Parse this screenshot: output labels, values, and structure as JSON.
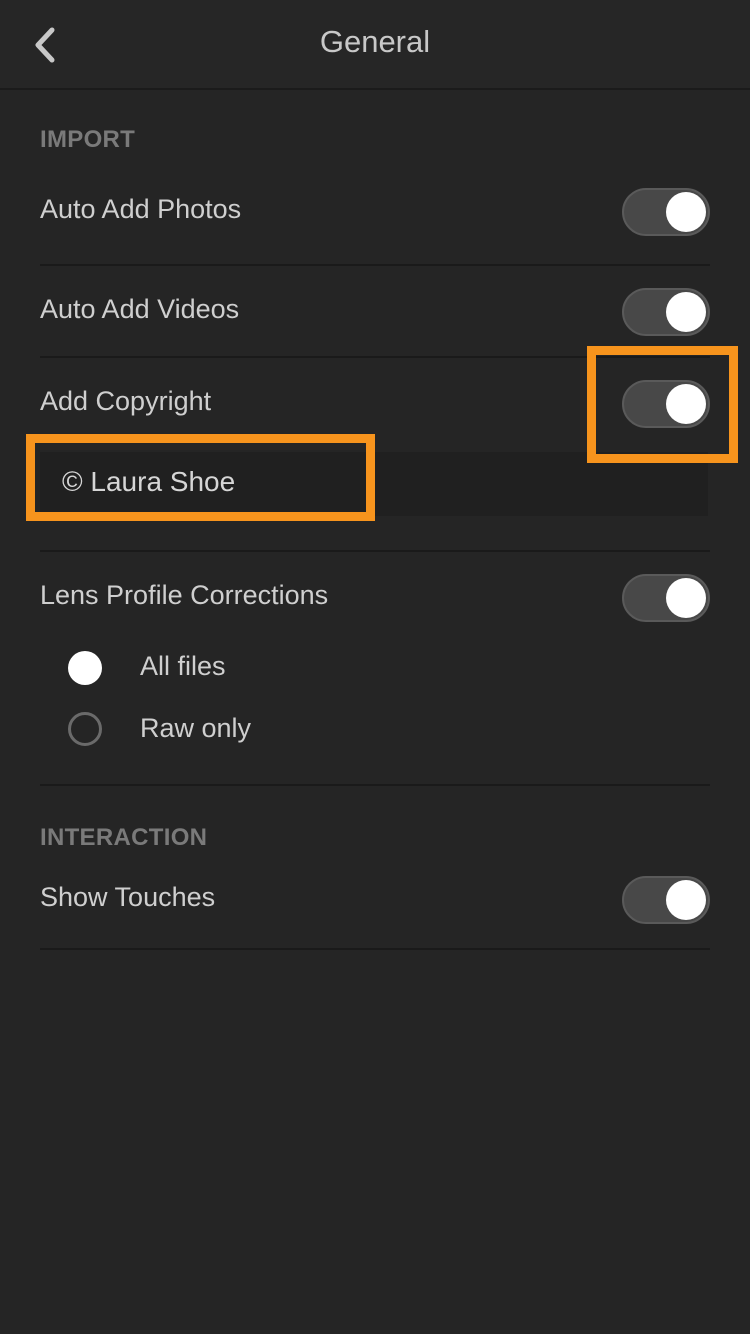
{
  "header": {
    "title": "General",
    "back_icon": "chevron-left-icon"
  },
  "sections": {
    "import": {
      "label": "IMPORT",
      "auto_add_photos": {
        "label": "Auto Add Photos",
        "enabled": true
      },
      "auto_add_videos": {
        "label": "Auto Add Videos",
        "enabled": true
      },
      "add_copyright": {
        "label": "Add Copyright",
        "enabled": true,
        "value": "© Laura Shoe"
      },
      "lens_profile": {
        "label": "Lens Profile Corrections",
        "enabled": true,
        "options": [
          {
            "label": "All files",
            "selected": true
          },
          {
            "label": "Raw only",
            "selected": false
          }
        ]
      }
    },
    "interaction": {
      "label": "INTERACTION",
      "show_touches": {
        "label": "Show Touches",
        "enabled": true
      }
    }
  },
  "annotations": {
    "highlight_color": "#f7941d"
  },
  "colors": {
    "background": "#252525",
    "toggle_track": "#484848",
    "toggle_knob": "#ffffff"
  }
}
